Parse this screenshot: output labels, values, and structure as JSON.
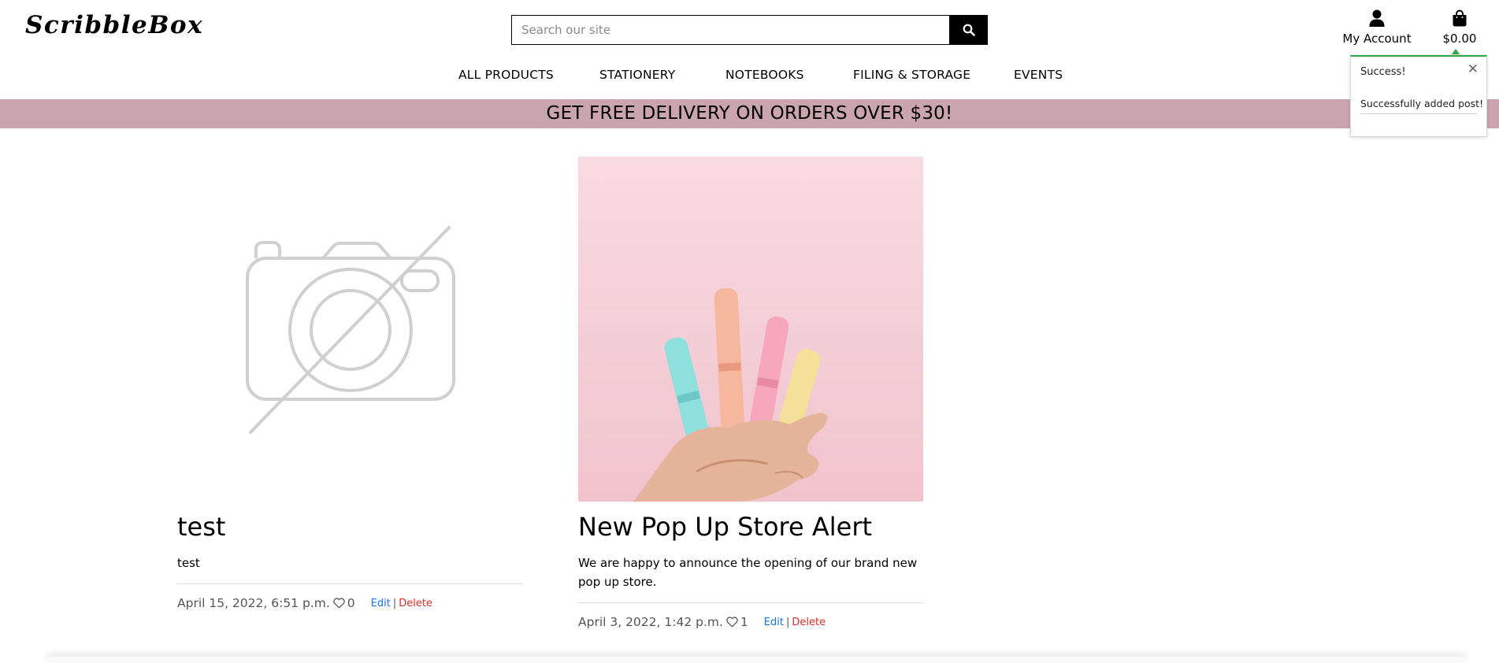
{
  "header": {
    "logo": "ScribbleBox",
    "search_placeholder": "Search our site",
    "account_label": "My Account",
    "cart_total": "$0.00",
    "icons": {
      "search": "search-icon",
      "account": "user-icon",
      "cart": "shopping-bag-icon"
    }
  },
  "nav": {
    "items": [
      {
        "label": "ALL PRODUCTS"
      },
      {
        "label": "STATIONERY"
      },
      {
        "label": "NOTEBOOKS"
      },
      {
        "label": "FILING & STORAGE"
      },
      {
        "label": "EVENTS"
      }
    ]
  },
  "banner": {
    "text": "GET FREE DELIVERY ON ORDERS OVER $30!",
    "color": "#caa5b0"
  },
  "toast": {
    "title": "Success!",
    "message": "Successfully added post!",
    "accent": "#28a745"
  },
  "posts": [
    {
      "title": "test",
      "body": "test",
      "date": "April 15, 2022, 6:51 p.m.",
      "likes": "0",
      "edit_label": "Edit",
      "delete_label": "Delete",
      "separator": "|",
      "image": "no-image-camera-placeholder"
    },
    {
      "title": "New Pop Up Store Alert",
      "body": "We are happy to announce the opening of our brand new pop up store.",
      "date": "April 3, 2022, 1:42 p.m.",
      "likes": "1",
      "edit_label": "Edit",
      "delete_label": "Delete",
      "separator": "|",
      "image": "hand-holding-pastel-highlighters"
    }
  ],
  "colors": {
    "edit_link": "#1a73e8",
    "delete_link": "#d9302c"
  }
}
